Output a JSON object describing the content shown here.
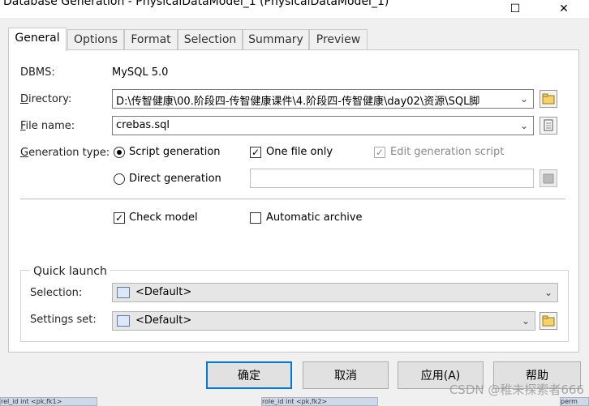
{
  "window": {
    "title": "Database Generation - PhysicalDataModel_1 (PhysicalDataModel_1)",
    "maximize_glyph": "☐",
    "close_glyph": "✕"
  },
  "tabs": [
    {
      "label": "General",
      "active": true
    },
    {
      "label": "Options"
    },
    {
      "label": "Format"
    },
    {
      "label": "Selection"
    },
    {
      "label": "Summary"
    },
    {
      "label": "Preview"
    }
  ],
  "general": {
    "dbms_label": "DBMS:",
    "dbms_value": "MySQL 5.0",
    "directory_label": "Directory:",
    "directory_value": "D:\\传智健康\\00.阶段四-传智健康课件\\4.阶段四-传智健康\\day02\\资源\\SQL脚",
    "filename_label": "File name:",
    "filename_value": "crebas.sql",
    "gentype_label": "Generation type:",
    "script_generation": "Script generation",
    "direct_generation": "Direct generation",
    "one_file_only": "One file only",
    "edit_generation_script": "Edit generation script",
    "check_model": "Check model",
    "automatic_archive": "Automatic archive"
  },
  "quick_launch": {
    "title": "Quick launch",
    "selection_label": "Selection:",
    "selection_value": "<Default>",
    "settings_label": "Settings set:",
    "settings_value": "<Default>"
  },
  "buttons": {
    "ok": "确定",
    "cancel": "取消",
    "apply": "应用(A)",
    "help": "帮助"
  },
  "watermark": "CSDN @稚未探索者666",
  "background_strip": [
    "rel_id   int   <pk,fk1>",
    "role_id   int   <pk,fk2>",
    "perm"
  ]
}
